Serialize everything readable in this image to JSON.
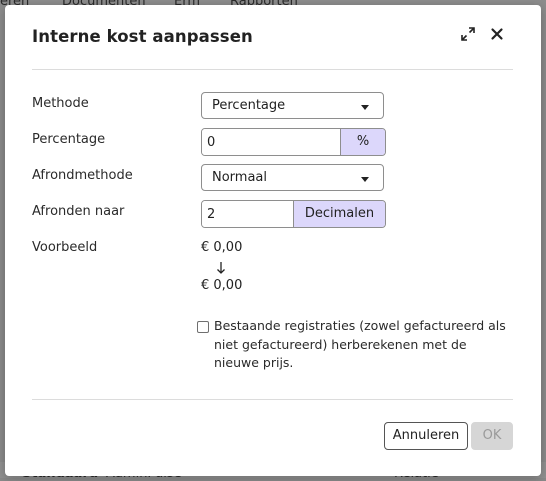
{
  "background": {
    "tabs": [
      "eren",
      "Documenten",
      "Erm",
      "Rapporten"
    ],
    "bottom_cells": [
      "Standaard",
      "AdminPulse",
      "Relatie"
    ]
  },
  "dialog": {
    "title": "Interne kost aanpassen",
    "expand_icon": "expand-arrows-icon",
    "close_icon": "close-x-icon",
    "fields": {
      "methode": {
        "label": "Methode",
        "value": "Percentage"
      },
      "percentage": {
        "label": "Percentage",
        "value": "0",
        "suffix": "%"
      },
      "afrondmethode": {
        "label": "Afrondmethode",
        "value": "Normaal"
      },
      "afronden_naar": {
        "label": "Afronden naar",
        "value": "2",
        "suffix": "Decimalen"
      },
      "voorbeeld": {
        "label": "Voorbeeld",
        "from": "€ 0,00",
        "to": "€ 0,00",
        "arrow_icon": "arrow-down-icon"
      }
    },
    "recalculate": {
      "checked": false,
      "label": "Bestaande registraties (zowel gefactureerd als niet gefactureerd) herberekenen met de nieuwe prijs."
    },
    "buttons": {
      "cancel": "Annuleren",
      "ok": "OK"
    }
  },
  "colors": {
    "addon_bg": "#dcd7fb",
    "overlay": "#8a8a8a",
    "ok_disabled_bg": "#d6d6d6"
  }
}
